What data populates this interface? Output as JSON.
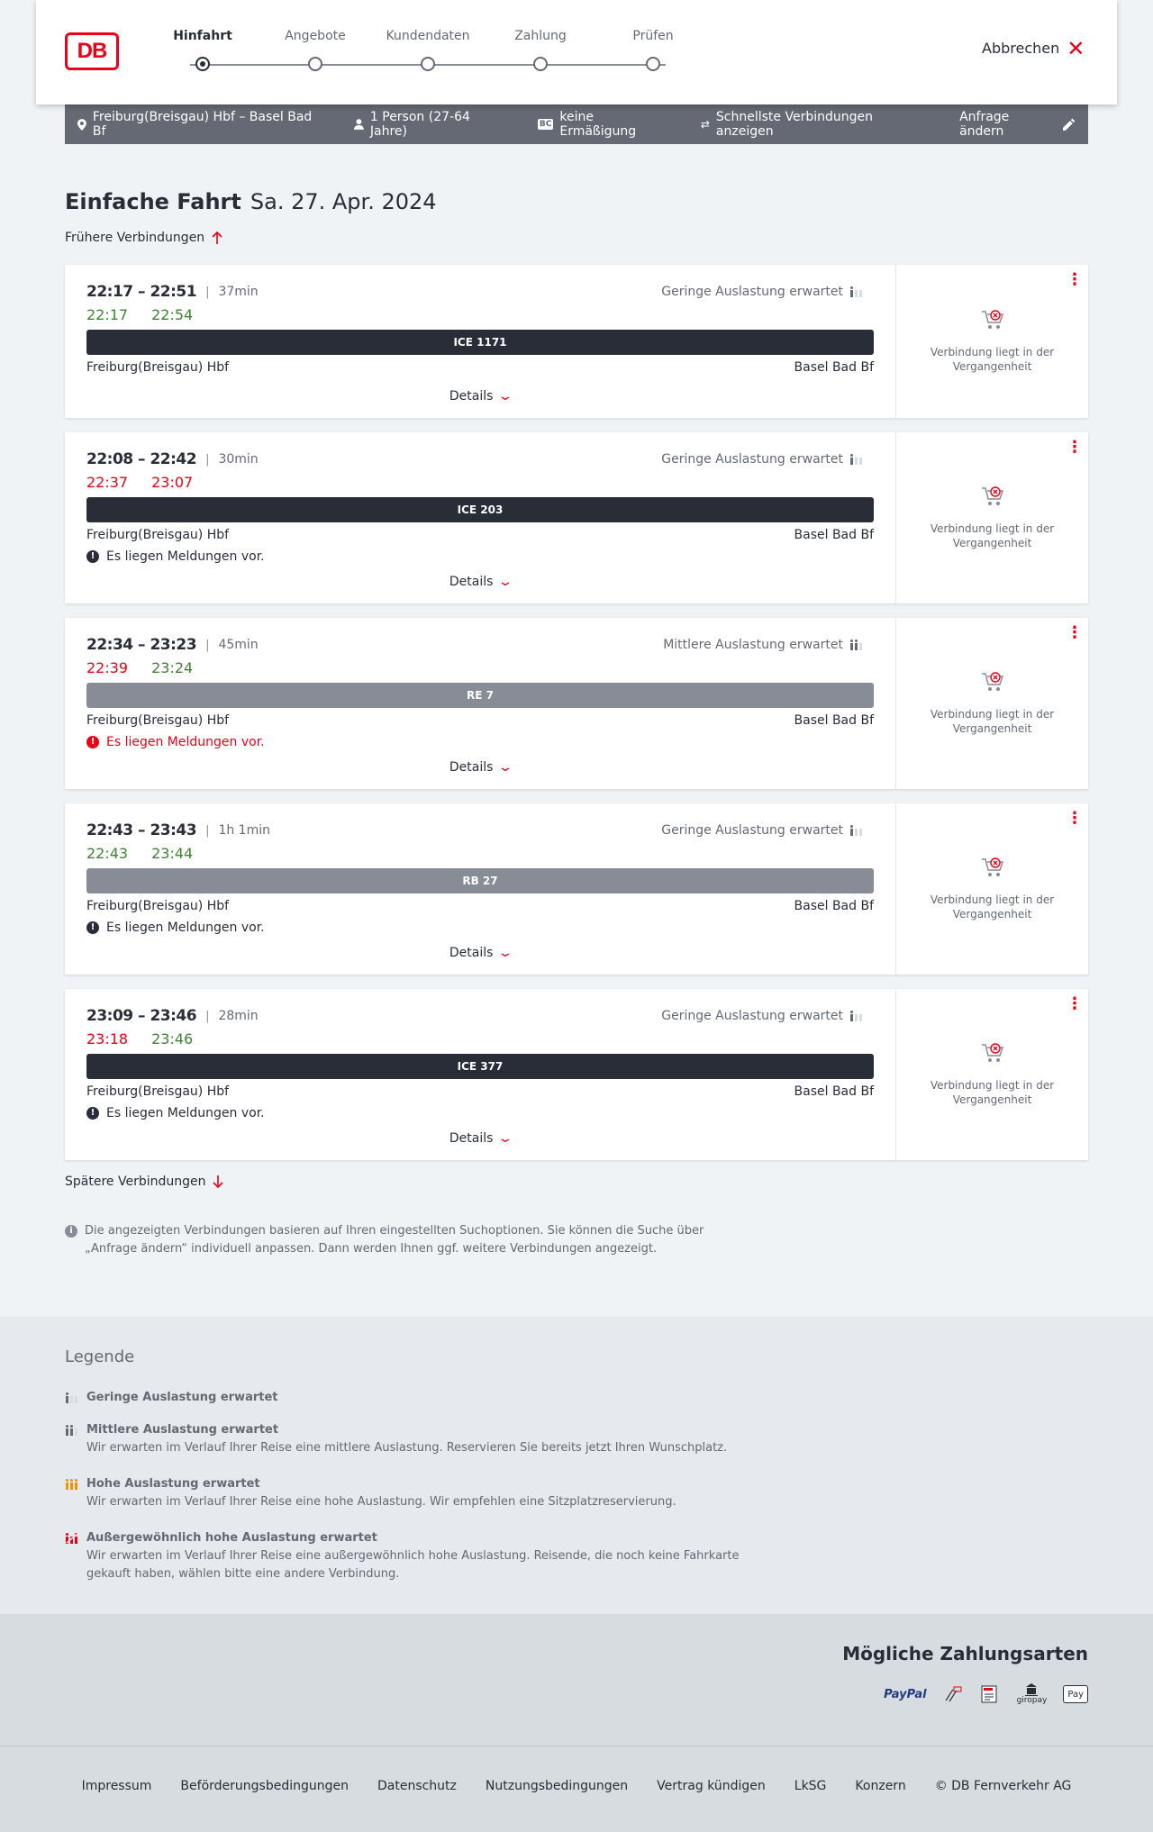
{
  "brand": {
    "logo_text": "DB",
    "accent": "#ec0016"
  },
  "stepper": {
    "steps": [
      {
        "label": "Hinfahrt",
        "active": true
      },
      {
        "label": "Angebote",
        "active": false
      },
      {
        "label": "Kundendaten",
        "active": false
      },
      {
        "label": "Zahlung",
        "active": false
      },
      {
        "label": "Prüfen",
        "active": false
      }
    ],
    "cancel_label": "Abbrechen"
  },
  "summary": {
    "route": "Freiburg(Breisgau) Hbf – Basel Bad Bf",
    "passengers": "1 Person (27-64 Jahre)",
    "discount_badge": "BC",
    "discount": "keine Ermäßigung",
    "option": "Schnellste Verbindungen anzeigen",
    "edit_label": "Anfrage ändern"
  },
  "heading": {
    "title": "Einfache Fahrt",
    "date": "Sa. 27. Apr. 2024"
  },
  "earlier_label": "Frühere Verbindungen",
  "later_label": "Spätere Verbindungen",
  "connections": [
    {
      "scheduled": "22:17 – 22:51",
      "duration": "37min",
      "load": "Geringe Auslastung erwartet",
      "rt_dep": "22:17",
      "rt_arr": "22:54",
      "train": "ICE 1171",
      "from": "Freiburg(Breisgau) Hbf",
      "to": "Basel Bad Bf",
      "message": "",
      "details": "Details",
      "status": "Verbindung liegt in der Vergangenheit"
    },
    {
      "scheduled": "22:08 – 22:42",
      "duration": "30min",
      "load": "Geringe Auslastung erwartet",
      "rt_dep": "22:37",
      "rt_arr": "23:07",
      "train": "ICE 203",
      "from": "Freiburg(Breisgau) Hbf",
      "to": "Basel Bad Bf",
      "message": "Es liegen Meldungen vor.",
      "details": "Details",
      "status": "Verbindung liegt in der Vergangenheit"
    },
    {
      "scheduled": "22:34 – 23:23",
      "duration": "45min",
      "load": "Mittlere Auslastung erwartet",
      "rt_dep": "22:39",
      "rt_arr": "23:24",
      "train": "RE 7",
      "from": "Freiburg(Breisgau) Hbf",
      "to": "Basel Bad Bf",
      "message": "Es liegen Meldungen vor.",
      "details": "Details",
      "status": "Verbindung liegt in der Vergangenheit"
    },
    {
      "scheduled": "22:43 – 23:43",
      "duration": "1h 1min",
      "load": "Geringe Auslastung erwartet",
      "rt_dep": "22:43",
      "rt_arr": "23:44",
      "train": "RB 27",
      "from": "Freiburg(Breisgau) Hbf",
      "to": "Basel Bad Bf",
      "message": "Es liegen Meldungen vor.",
      "details": "Details",
      "status": "Verbindung liegt in der Vergangenheit"
    },
    {
      "scheduled": "23:09 – 23:46",
      "duration": "28min",
      "load": "Geringe Auslastung erwartet",
      "rt_dep": "23:18",
      "rt_arr": "23:46",
      "train": "ICE 377",
      "from": "Freiburg(Breisgau) Hbf",
      "to": "Basel Bad Bf",
      "message": "Es liegen Meldungen vor.",
      "details": "Details",
      "status": "Verbindung liegt in der Vergangenheit"
    }
  ],
  "info_text": "Die angezeigten Verbindungen basieren auf Ihren eingestellten Suchoptionen. Sie können die Suche über „Anfrage ändern“ individuell anpassen. Dann werden Ihnen ggf. weitere Verbindungen angezeigt.",
  "legend": {
    "title": "Legende",
    "items": [
      {
        "title": "Geringe Auslastung erwartet",
        "text": ""
      },
      {
        "title": "Mittlere Auslastung erwartet",
        "text": "Wir erwarten im Verlauf Ihrer Reise eine mittlere Auslastung. Reservieren Sie bereits jetzt Ihren Wunschplatz."
      },
      {
        "title": "Hohe Auslastung erwartet",
        "text": "Wir erwarten im Verlauf Ihrer Reise eine hohe Auslastung. Wir empfehlen eine Sitzplatzreservierung."
      },
      {
        "title": "Außergewöhnlich hohe Auslastung erwartet",
        "text": "Wir erwarten im Verlauf Ihrer Reise eine außergewöhnlich hohe Auslastung. Reisende, die noch keine Fahrkarte gekauft haben, wählen bitte eine andere Verbindung."
      }
    ]
  },
  "payment": {
    "title": "Mögliche Zahlungsarten",
    "methods": [
      "PayPal",
      "credit-card-icon",
      "sepa-icon",
      "giropay",
      "Pay"
    ]
  },
  "footer": {
    "links": [
      "Impressum",
      "Beförderungsbedingungen",
      "Datenschutz",
      "Nutzungsbedingungen",
      "Vertrag kündigen",
      "LkSG",
      "Konzern",
      "© DB Fernverkehr AG"
    ]
  },
  "colors": {
    "delay": "#ec0016",
    "ontime": "#408335",
    "train_dark": "#282d37",
    "train_gray": "#878c96",
    "load_high": "#f39200"
  }
}
